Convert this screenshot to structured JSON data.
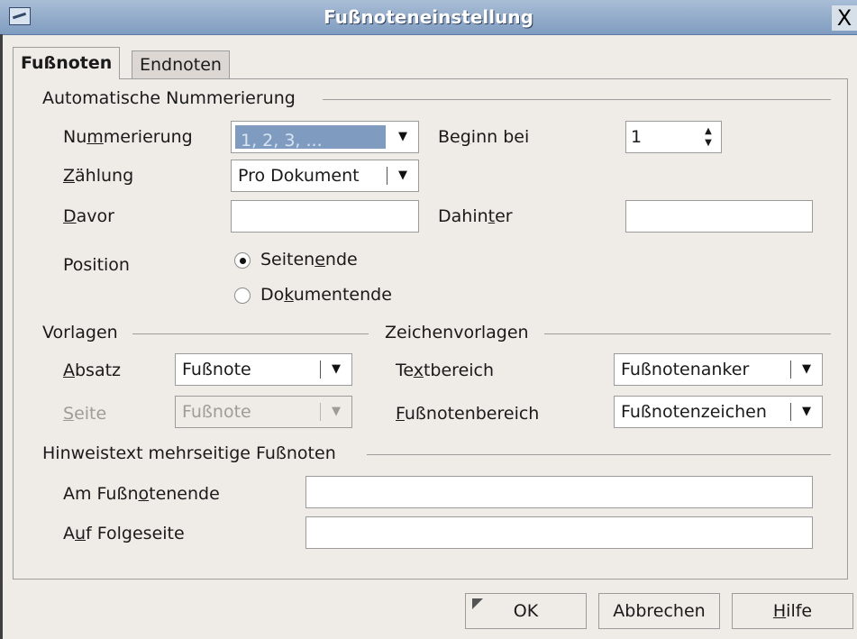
{
  "window": {
    "title": "Fußnoteneinstellung",
    "close": "X"
  },
  "tabs": [
    {
      "label": "Fußnoten"
    },
    {
      "label": "Endnoten"
    }
  ],
  "auto": {
    "heading": "Automatische Nummerierung",
    "numbering_label": {
      "pre": "Nu",
      "ul": "m",
      "post": "merierung"
    },
    "numbering_value": "1, 2, 3, ...",
    "start_label": {
      "pre": "Be",
      "ul": "g",
      "post": "inn bei"
    },
    "start_value": "1",
    "counting_label": {
      "pre": "",
      "ul": "Z",
      "post": "ählung"
    },
    "counting_value": "Pro Dokument",
    "before_label": {
      "pre": "",
      "ul": "D",
      "post": "avor"
    },
    "before_value": "",
    "after_label": {
      "pre": "Dahin",
      "ul": "t",
      "post": "er"
    },
    "after_value": "",
    "position_label": "Position",
    "pos_page": {
      "pre": "Seiten",
      "ul": "e",
      "post": "nde"
    },
    "pos_doc": {
      "pre": "Do",
      "ul": "k",
      "post": "umentende"
    }
  },
  "templates": {
    "heading": "Vorlagen",
    "paragraph_label": {
      "pre": "",
      "ul": "A",
      "post": "bsatz"
    },
    "paragraph_value": "Fußnote",
    "page_label": {
      "pre": "",
      "ul": "S",
      "post": "eite"
    },
    "page_value": "Fußnote"
  },
  "char_templates": {
    "heading": "Zeichenvorlagen",
    "text_label": {
      "pre": "Te",
      "ul": "x",
      "post": "tbereich"
    },
    "text_value": "Fußnotenanker",
    "footnote_label": {
      "pre": "",
      "ul": "F",
      "post": "ußnotenbereich"
    },
    "footnote_value": "Fußnotenzeichen"
  },
  "continuation": {
    "heading": "Hinweistext mehrseitige Fußnoten",
    "end_label": {
      "pre": "Am Fußn",
      "ul": "o",
      "post": "tenende"
    },
    "end_value": "",
    "next_label": {
      "pre": "A",
      "ul": "u",
      "post": "f Folgeseite"
    },
    "next_value": ""
  },
  "buttons": {
    "ok": "OK",
    "cancel": "Abbrechen",
    "help": {
      "pre": "",
      "ul": "H",
      "post": "ilfe"
    }
  }
}
